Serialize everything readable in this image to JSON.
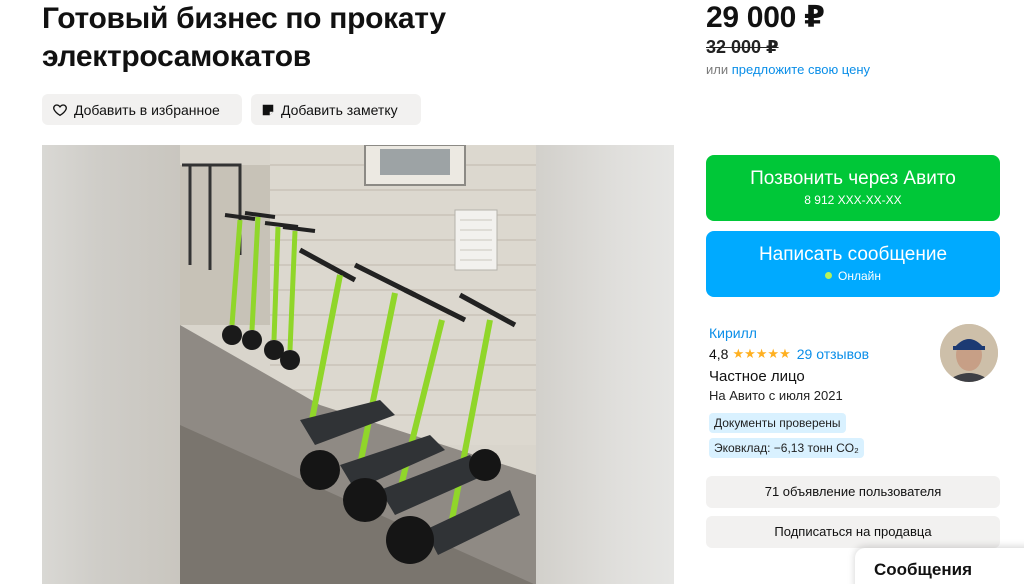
{
  "listing": {
    "title": "Готовый бизнес по прокату электросамокатов"
  },
  "actions": {
    "favorite_label": "Добавить в избранное",
    "note_label": "Добавить заметку"
  },
  "price": {
    "current": "29 000 ₽",
    "old": "32 000 ₽",
    "offer_prefix": "или",
    "offer_link": "предложите свою цену"
  },
  "contact": {
    "call_label": "Позвонить через Авито",
    "phone": "8 912 XXX-XX-XX",
    "message_label": "Написать сообщение",
    "status": "Онлайн"
  },
  "seller": {
    "name": "Кирилл",
    "rating": "4,8",
    "stars": 5,
    "reviews": "29 отзывов",
    "type": "Частное лицо",
    "since": "На Авито с июля 2021",
    "badges": [
      "Документы проверены",
      "Эковклад: −6,13 тонн CO₂"
    ]
  },
  "seller_links": {
    "ads": "71 объявление пользователя",
    "subscribe": "Подписаться на продавца"
  },
  "messages_tab": "Сообщения",
  "colors": {
    "call_green": "#00c738",
    "message_blue": "#00aaff",
    "link_blue": "#0a8ee8",
    "star": "#ffb021",
    "badge_bg": "#d9f1ff"
  },
  "icons": [
    "heart-icon",
    "note-icon",
    "star-icon",
    "online-dot-icon"
  ]
}
